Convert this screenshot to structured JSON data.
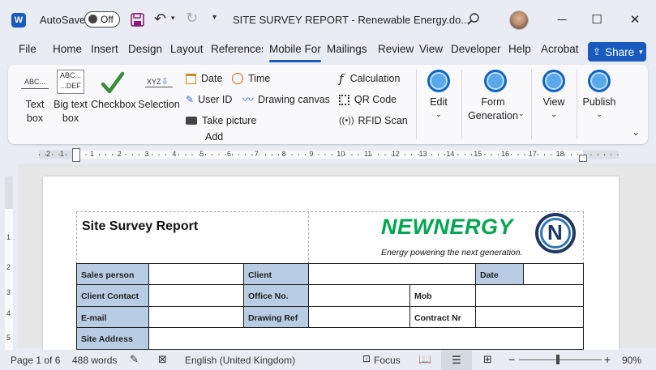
{
  "titlebar": {
    "autosave_label": "AutoSave",
    "autosave_state": "Off",
    "doc_title": "SITE SURVEY REPORT - Renewable Energy.do...",
    "minimize": "─",
    "maximize": "☐",
    "close": "✕"
  },
  "tabs": [
    {
      "label": "File"
    },
    {
      "label": "Home"
    },
    {
      "label": "Insert"
    },
    {
      "label": "Design"
    },
    {
      "label": "Layout"
    },
    {
      "label": "References"
    },
    {
      "label": "Mobile For"
    },
    {
      "label": "Mailings"
    },
    {
      "label": "Review"
    },
    {
      "label": "View"
    },
    {
      "label": "Developer"
    },
    {
      "label": "Help"
    },
    {
      "label": "Acrobat"
    }
  ],
  "share_label": "Share",
  "ribbon": {
    "textbox": "Text\nbox",
    "bigtext": "Big text\nbox",
    "checkbox": "Checkbox",
    "selection": "Selection",
    "abc_icon": "ABC...",
    "abcdef_icon": "ABC...\n...DEF",
    "xyz_icon": "XYZ",
    "date": "Date",
    "time": "Time",
    "userid": "User ID",
    "drawing": "Drawing canvas",
    "picture": "Take picture",
    "calc": "Calculation",
    "qr": "QR Code",
    "rfid": "RFID Scan",
    "add_group": "Add",
    "edit": "Edit",
    "formgen": "Form\nGeneration",
    "view": "View",
    "publish": "Publish"
  },
  "ruler": {
    "left": [
      "1",
      "2"
    ],
    "right": [
      "1",
      "2",
      "3",
      "4",
      "5",
      "6",
      "7",
      "8",
      "9",
      "10",
      "11",
      "12",
      "13",
      "14",
      "15",
      "16",
      "17",
      "18"
    ],
    "vertical": [
      "1",
      "2",
      "3",
      "4",
      "5"
    ]
  },
  "document": {
    "report_title": "Site Survey Report",
    "logo_text": "NEWNERGY",
    "logo_badge": "N",
    "tagline": "Energy powering the next generation.",
    "labels": {
      "sales": "Sales person",
      "client": "Client",
      "date": "Date",
      "contact": "Client Contact",
      "office": "Office No.",
      "mob": "Mob",
      "email": "E-mail",
      "drawing_ref": "Drawing Ref",
      "contract": "Contract Nr",
      "address": "Site Address"
    }
  },
  "status": {
    "page": "Page 1 of 6",
    "words": "488 words",
    "language": "English (United Kingdom)",
    "focus": "Focus",
    "zoom_minus": "−",
    "zoom_plus": "+",
    "zoom": "90%"
  },
  "colors": {
    "accent": "#185abd",
    "label_fill": "#b8cce4",
    "logo_green": "#00a651",
    "logo_navy": "#1f3864"
  }
}
